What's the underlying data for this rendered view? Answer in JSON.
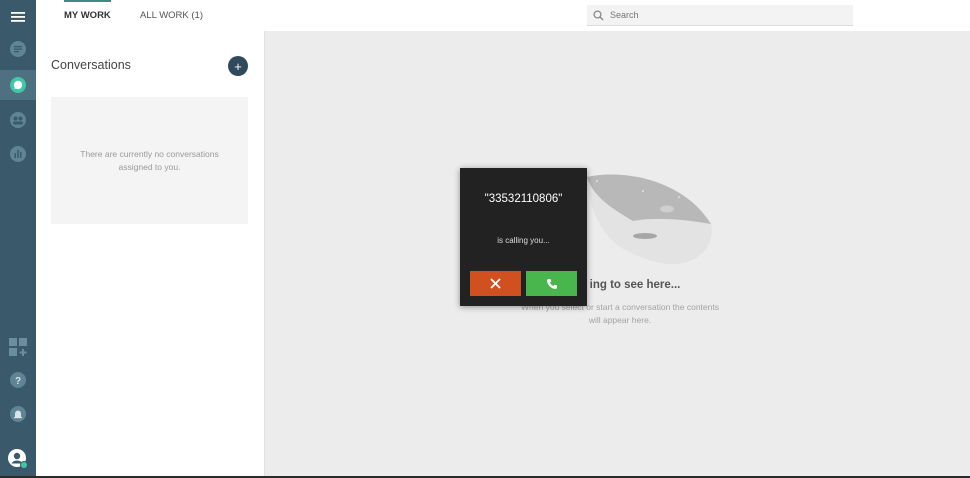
{
  "tabs": [
    {
      "label": "MY WORK",
      "active": true
    },
    {
      "label": "ALL WORK (1)",
      "active": false
    }
  ],
  "search": {
    "placeholder": "Search"
  },
  "rail": {
    "top_icons": [
      "menu-icon",
      "messages-icon",
      "chat-icon",
      "contacts-icon",
      "reports-icon"
    ],
    "bottom_icons": [
      "apps-icon",
      "help-icon",
      "notifications-icon",
      "avatar"
    ]
  },
  "conversations": {
    "title": "Conversations",
    "add_label": "+",
    "empty_text": "There are currently no conversations assigned to you."
  },
  "main": {
    "empty_title": "ing to see here...",
    "empty_desc": "When you select or start a conversation the contents will appear here."
  },
  "call": {
    "caller": "\"33532110806\"",
    "message": "is calling you..."
  },
  "colors": {
    "rail": "#3a5a6b",
    "accent": "#3a8b82",
    "reject": "#d1501f",
    "accept": "#48b64c"
  }
}
